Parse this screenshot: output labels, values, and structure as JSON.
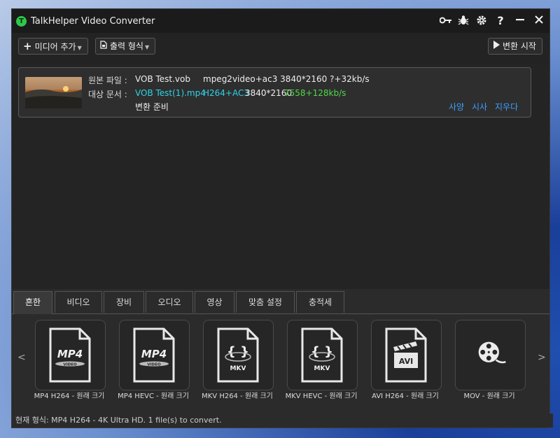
{
  "app": {
    "title": "TalkHelper Video Converter",
    "logo_letter": "T"
  },
  "titlebar": {
    "icons": [
      "key-icon",
      "bug-icon",
      "gear-icon",
      "help-icon",
      "minimize-icon",
      "close-icon"
    ],
    "help_glyph": "?"
  },
  "toolbar": {
    "add_media_label": "미디어 추가",
    "output_format_label": "출력 형식",
    "start_convert_label": "변환 시작"
  },
  "file": {
    "source_label": "원본 파일 :",
    "source_name": "VOB Test.vob",
    "source_info": "mpeg2video+ac3 3840*2160 ?+32kb/s",
    "target_label": "대상 문서 :",
    "target_name": "VOB Test(1).mp4",
    "target_codec": "H264+AC3",
    "target_res": "3840*2160",
    "target_bitrate": "7558+128kb/s",
    "status": "변환 준비",
    "actions": [
      "사양",
      "시사",
      "지우다"
    ]
  },
  "tabs": [
    "흔한",
    "비디오",
    "장비",
    "오디오",
    "영상",
    "맞춤 설정",
    "충적세"
  ],
  "formats": [
    {
      "name": "MP4 H264 - 원래 크기",
      "badge": "MP4",
      "sub": "VIDEO",
      "icon": "mp4-file-icon"
    },
    {
      "name": "MP4 HEVC - 원래 크기",
      "badge": "MP4",
      "sub": "VIDEO",
      "icon": "mp4-file-icon"
    },
    {
      "name": "MKV H264 - 원래 크기",
      "badge": "MKV",
      "sub": "",
      "icon": "mkv-file-icon"
    },
    {
      "name": "MKV HEVC - 원래 크기",
      "badge": "MKV",
      "sub": "",
      "icon": "mkv-file-icon"
    },
    {
      "name": "AVI H264 - 원래 크기",
      "badge": "AVI",
      "sub": "",
      "icon": "avi-file-icon"
    },
    {
      "name": "MOV - 원래 크기",
      "badge": "",
      "sub": "",
      "icon": "film-reel-icon"
    }
  ],
  "nav": {
    "prev": "<",
    "next": ">"
  },
  "status": "현재 형식: MP4 H264 - 4K Ultra HD. 1 file(s) to convert."
}
